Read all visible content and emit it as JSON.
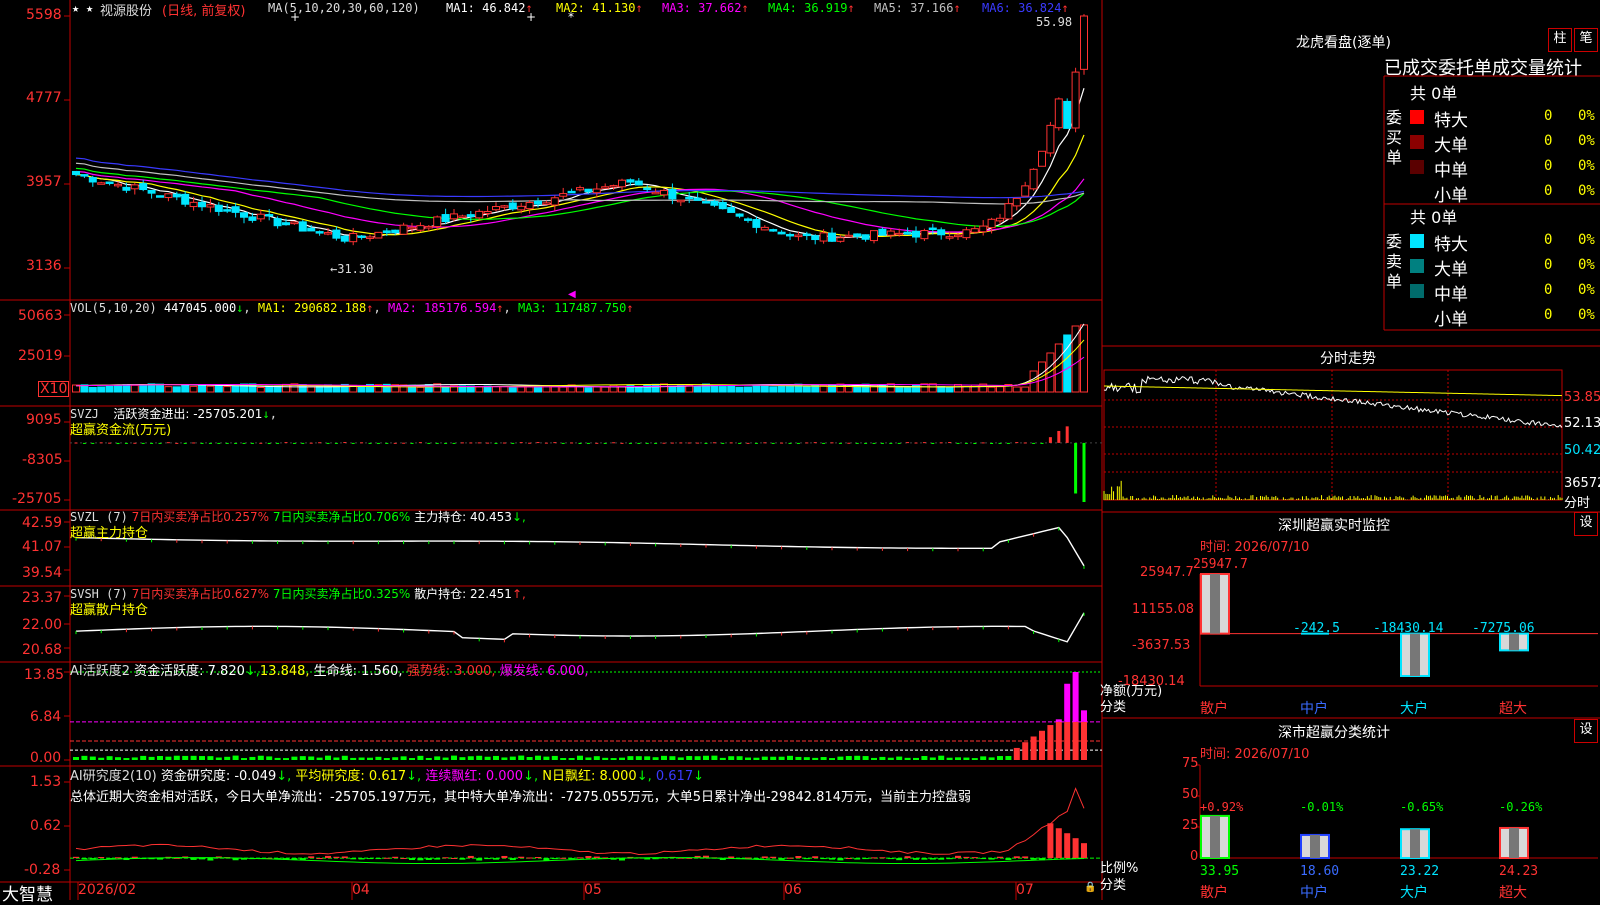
{
  "colors": {
    "up": "#ff3232",
    "down": "#00e5ff",
    "grid": "#c00000",
    "ma1": "#ffffff",
    "ma2": "#ffff00",
    "ma3": "#ff00ff",
    "ma4": "#00ff00",
    "ma5": "#c0c0c0",
    "ma6": "#3a3aff",
    "vol_line": "#ffff00"
  },
  "brand": "大智慧",
  "stock": {
    "name": "视源股份",
    "mode": "(日线, 前复权)",
    "ma_header": "MA(5,10,20,30,60,120)",
    "ma": [
      {
        "label": "MA1: 46.842",
        "arrow": "↑"
      },
      {
        "label": "MA2: 41.130",
        "arrow": "↑"
      },
      {
        "label": "MA3: 37.662",
        "arrow": "↑"
      },
      {
        "label": "MA4: 36.919",
        "arrow": "↑"
      },
      {
        "label": "MA5: 37.166",
        "arrow": "↑"
      },
      {
        "label": "MA6: 36.824",
        "arrow": "↑"
      }
    ],
    "high_label": "55.98",
    "low_label": "31.30"
  },
  "axes": {
    "price": [
      "5598",
      "4777",
      "3957",
      "3136"
    ],
    "vol": [
      "50663",
      "25019"
    ],
    "vol_unit": "X10",
    "svzj": [
      "9095",
      "-8305",
      "-25705"
    ],
    "svzl": [
      "42.59",
      "41.07",
      "39.54"
    ],
    "svsh": [
      "23.37",
      "22.00",
      "20.68"
    ],
    "ai1": [
      "13.85",
      "6.84",
      "0.00"
    ],
    "ai2": [
      "1.53",
      "0.62",
      "-0.28"
    ],
    "dates": [
      "2026/02",
      "04",
      "05",
      "06",
      "07"
    ]
  },
  "vol_header": {
    "title": "VOL(5,10,20)",
    "value": "447045.000",
    "arrow": "↓",
    "ma1": "MA1: 290682.188",
    "ma1a": "↑",
    "ma2": "MA2: 185176.594",
    "ma2a": "↑",
    "ma3": "MA3: 117487.750",
    "ma3a": "↑"
  },
  "svzj_header": {
    "title": "SVZJ",
    "label": "活跃资金进出: -25705.201",
    "arrow": "↓",
    "sub": "超赢资金流(万元)"
  },
  "svzl_header": {
    "title": "SVZL (7)",
    "p1": "7日内买卖净占比0.257%",
    "p2": "7日内买卖净占比0.706%",
    "p3": "主力持仓: 40.453",
    "arrow": "↓,",
    "sub": "超赢主力持仓"
  },
  "svsh_header": {
    "title": "SVSH (7)",
    "p1": "7日内买卖净占比0.627%",
    "p2": "7日内买卖净占比0.325%",
    "p3": "散户持仓: 22.451",
    "arrow": "↑,",
    "sub": "超赢散户持仓"
  },
  "ai1_header": {
    "title": "AI活跃度2",
    "a": "资金活跃度: 7.820",
    "aa": "↓,",
    "b": "13.848,",
    "c": "生命线: 1.560,",
    "d": "强势线: 3.000,",
    "e": "爆发线: 6.000,"
  },
  "ai2_header": {
    "title": "AI研究度2(10)",
    "a": "资金研究度: -0.049",
    "aa": "↓,",
    "b": "平均研究度: 0.617",
    "ba": "↓,",
    "c": "连续飘红: 0.000",
    "ca": "↓,",
    "d": "N日飘红: 8.000",
    "da": "↓,",
    "e": "0.617",
    "ea": "↓"
  },
  "summary": "总体近期大资金相对活跃，今日大单净流出：-25705.197万元，其中特大单净流出：-7275.055万元，大单5日累计净出-29842.814万元，当前主力控盘弱",
  "right": {
    "lhb_title": "龙虎看盘(逐单)",
    "btn_zhu": "柱",
    "btn_bi": "笔",
    "table_title": "已成交委托单成交量统计",
    "buy_label": "委买单",
    "sell_label": "委卖单",
    "buy_total": "共 0单",
    "sell_total": "共 0单",
    "buy_rows": [
      {
        "name": "特大",
        "val": "0",
        "pct": "0%",
        "color": "#ff0000"
      },
      {
        "name": "大单",
        "val": "0",
        "pct": "0%",
        "color": "#8b0000"
      },
      {
        "name": "中单",
        "val": "0",
        "pct": "0%",
        "color": "#5a0000"
      },
      {
        "name": "小单",
        "val": "0",
        "pct": "0%",
        "color": ""
      }
    ],
    "sell_rows": [
      {
        "name": "特大",
        "val": "0",
        "pct": "0%",
        "color": "#00e5ff"
      },
      {
        "name": "大单",
        "val": "0",
        "pct": "0%",
        "color": "#008080"
      },
      {
        "name": "中单",
        "val": "0",
        "pct": "0%",
        "color": "#006b6b"
      },
      {
        "name": "小单",
        "val": "0",
        "pct": "0%",
        "color": ""
      }
    ],
    "intraday_title": "分时走势",
    "intraday_axis": [
      "53.85",
      "52.13",
      "50.42",
      "36572",
      "分时"
    ],
    "sz_title": "深圳超赢实时监控",
    "sz_btn": "设",
    "sz_time": "时间: 2026/07/10",
    "sz_axis": [
      "25947.7",
      "11155.08",
      "-3637.53",
      "-18430.14"
    ],
    "sz_unit": "净额(万元)",
    "sz_unit2": "分类",
    "sz_bars": [
      {
        "cat": "散户",
        "value": 25947.7,
        "label": "25947.7"
      },
      {
        "cat": "中户",
        "value": -242.5,
        "label": "-242.5"
      },
      {
        "cat": "大户",
        "value": -18430.14,
        "label": "-18430.14"
      },
      {
        "cat": "超大",
        "value": -7275.06,
        "label": "-7275.06"
      }
    ],
    "fl_title": "深市超赢分类统计",
    "fl_btn": "设",
    "fl_time": "时间: 2026/07/10",
    "fl_axis": [
      "75",
      "50",
      "25",
      "0"
    ],
    "fl_unit": "比例%",
    "fl_unit2": "分类",
    "fl_bars": [
      {
        "cat": "散户",
        "value": 33.95,
        "label": "33.95",
        "chg": "+0.92%"
      },
      {
        "cat": "中户",
        "value": 18.6,
        "label": "18.60",
        "chg": "-0.01%"
      },
      {
        "cat": "大户",
        "value": 23.22,
        "label": "23.22",
        "chg": "-0.65%"
      },
      {
        "cat": "超大",
        "value": 24.23,
        "label": "24.23",
        "chg": "-0.26%"
      }
    ]
  }
}
